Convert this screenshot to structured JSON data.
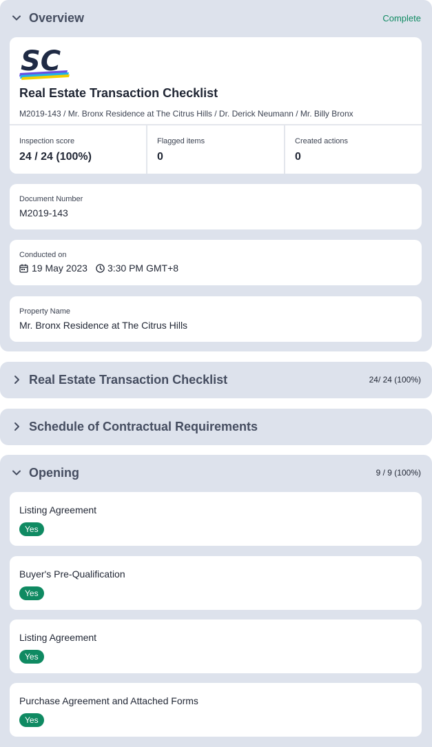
{
  "overview": {
    "title": "Overview",
    "status": "Complete",
    "report": {
      "logo_alt": "SC",
      "title": "Real Estate Transaction Checklist",
      "subtitle": "M2019-143 / Mr. Bronx Residence at The Citrus Hills / Dr. Derick Neumann / Mr. Billy Bronx"
    },
    "stats": [
      {
        "label": "Inspection score",
        "value": "24 / 24 (100%)"
      },
      {
        "label": "Flagged items",
        "value": "0"
      },
      {
        "label": "Created actions",
        "value": "0"
      }
    ],
    "document_number": {
      "label": "Document Number",
      "value": "M2019-143"
    },
    "conducted_on": {
      "label": "Conducted on",
      "date": "19 May 2023",
      "time": "3:30 PM GMT+8"
    },
    "property_name": {
      "label": "Property Name",
      "value": "Mr. Bronx Residence at The Citrus Hills"
    }
  },
  "sections": [
    {
      "title": "Real Estate Transaction Checklist",
      "score": "24/ 24 (100%)"
    },
    {
      "title": "Schedule of Contractual Requirements",
      "score": ""
    }
  ],
  "opening": {
    "title": "Opening",
    "score": "9 / 9 (100%)",
    "items": [
      {
        "label": "Listing Agreement",
        "answer": "Yes"
      },
      {
        "label": "Buyer's Pre-Qualification",
        "answer": "Yes"
      },
      {
        "label": "Listing Agreement",
        "answer": "Yes"
      },
      {
        "label": "Purchase Agreement and Attached Forms",
        "answer": "Yes"
      }
    ]
  },
  "colors": {
    "section_bg": "#dde2ec",
    "accent_green": "#0f8a62",
    "logo_navy": "#1f2a44"
  },
  "icons": {
    "expand": "chevron-down-icon",
    "collapse": "chevron-right-icon",
    "date": "calendar-icon",
    "time": "clock-icon"
  }
}
